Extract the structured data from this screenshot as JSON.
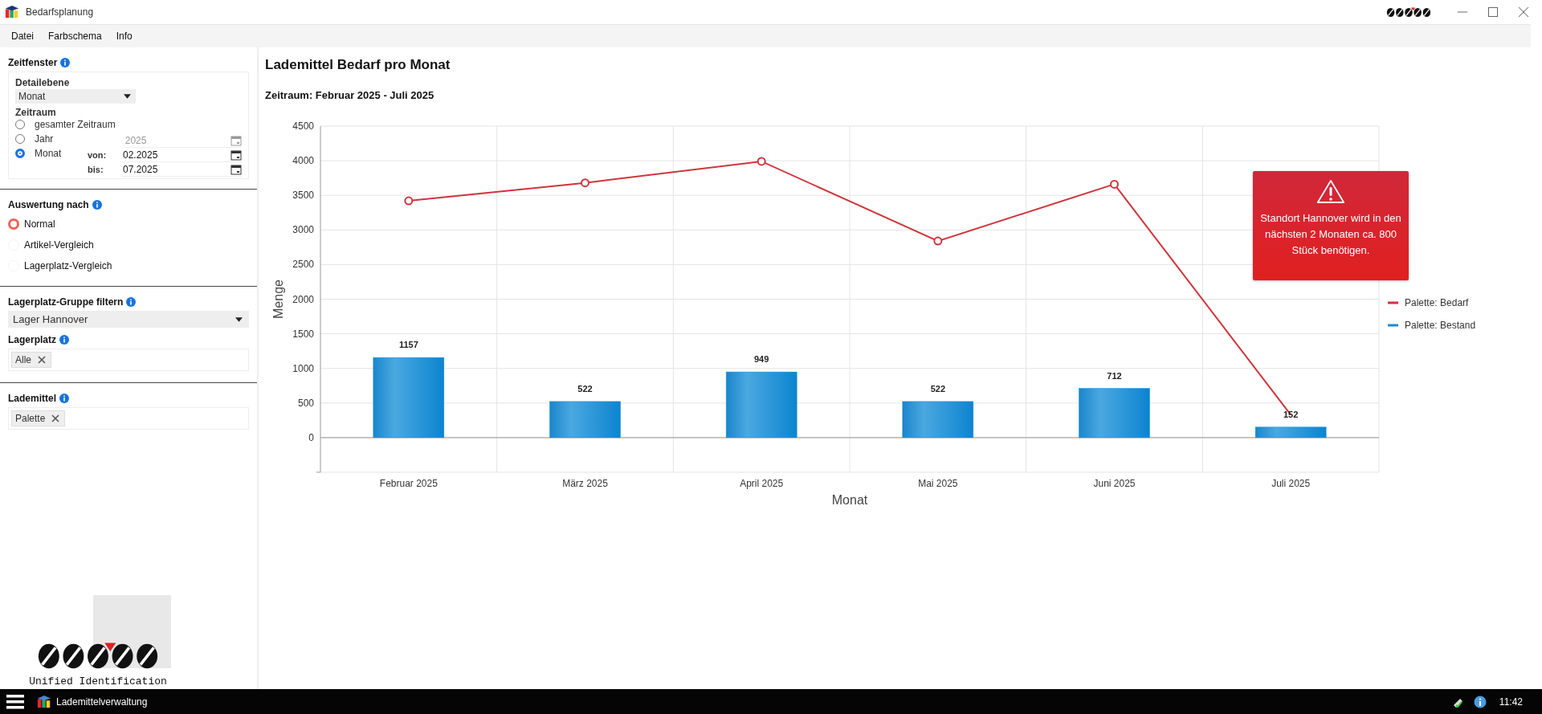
{
  "window": {
    "title": "Bedarfsplanung"
  },
  "menu": [
    "Datei",
    "Farbschema",
    "Info"
  ],
  "zeitfenster": {
    "title": "Zeitfenster",
    "detail_label": "Detailebene",
    "detail_value": "Monat",
    "zeitraum_label": "Zeitraum",
    "options": [
      {
        "label": "gesamter Zeitraum",
        "selected": false
      },
      {
        "label": "Jahr",
        "selected": false
      },
      {
        "label": "Monat",
        "selected": true
      }
    ],
    "year": {
      "value": "2025",
      "disabled": true
    },
    "from_label": "von:",
    "from_value": "02.2025",
    "to_label": "bis:",
    "to_value": "07.2025"
  },
  "auswertung": {
    "title": "Auswertung nach",
    "options": [
      {
        "label": "Normal",
        "selected": true
      },
      {
        "label": "Artikel-Vergleich",
        "selected": false
      },
      {
        "label": "Lagerplatz-Vergleich",
        "selected": false
      }
    ]
  },
  "gruppe": {
    "title": "Lagerplatz-Gruppe filtern",
    "value": "Lager Hannover"
  },
  "lagerplatz": {
    "title": "Lagerplatz",
    "tags": [
      "Alle"
    ]
  },
  "lademittel": {
    "title": "Lademittel",
    "tags": [
      "Palette"
    ]
  },
  "logo_caption": "Unified Identification",
  "main": {
    "title": "Lademittel Bedarf pro Monat",
    "subtitle": "Zeitraum: Februar 2025 - Juli 2025",
    "alert": {
      "text": "Standort Hannover wird in den nächsten 2 Monaten ca. 800 Stück benötigen."
    },
    "chart_data": {
      "type": "bar",
      "xlabel": "Monat",
      "ylabel": "Menge",
      "categories": [
        "Februar 2025",
        "März 2025",
        "April 2025",
        "Mai 2025",
        "Juni 2025",
        "Juli 2025"
      ],
      "series": [
        {
          "name": "Palette: Bedarf",
          "type": "line",
          "color": "#d0343c",
          "marker": "circle",
          "values": [
            3420,
            3680,
            3990,
            2840,
            3660,
            330
          ]
        },
        {
          "name": "Palette: Bestand",
          "type": "bar",
          "color": "#1a8ad4",
          "values": [
            1157,
            522,
            949,
            522,
            712,
            152
          ],
          "value_labels": [
            "1157",
            "522",
            "949",
            "522",
            "712",
            "152"
          ]
        }
      ],
      "ylim": [
        -500,
        4500
      ],
      "yticks": [
        0,
        500,
        1000,
        1500,
        2000,
        2500,
        3000,
        3500,
        4000,
        4500
      ],
      "grid": true,
      "legend": "right"
    }
  },
  "taskbar": {
    "app": "Lademittelverwaltung",
    "time": "11:42"
  }
}
